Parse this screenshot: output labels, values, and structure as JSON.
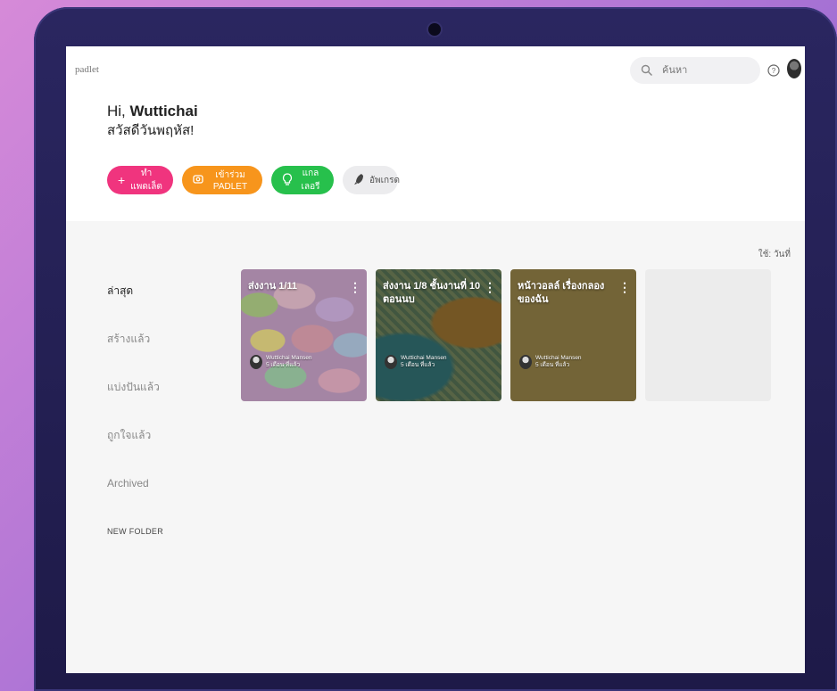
{
  "app": {
    "logo": "padlet"
  },
  "search": {
    "placeholder": "ค้นหา"
  },
  "greeting": {
    "hi_prefix": "Hi,",
    "name": "Wuttichai",
    "subtitle": "สวัสดีวันพฤหัส!"
  },
  "actions": [
    {
      "label": "ทำแพดเล็ต",
      "icon": "plus-icon",
      "color": "#f0347e"
    },
    {
      "label": "เข้าร่วม PADLET",
      "icon": "qr-scan-icon",
      "color": "#f7951c"
    },
    {
      "label": "แกลเลอรี",
      "icon": "lightbulb-icon",
      "color": "#27c04c"
    },
    {
      "label": "อัพเกรด",
      "icon": "rocket-icon",
      "color": "#ececee"
    }
  ],
  "sort": {
    "label": "ใช้: วันที่"
  },
  "sidebar": {
    "items": [
      {
        "label": "ล่าสุด",
        "active": true
      },
      {
        "label": "สร้างแล้ว"
      },
      {
        "label": "แบ่งปันแล้ว"
      },
      {
        "label": "ถูกใจแล้ว"
      },
      {
        "label": "Archived"
      }
    ],
    "new_folder": "NEW FOLDER"
  },
  "cards": [
    {
      "title": "ส่งงาน 1/11",
      "author": "Wuttichai Mansen",
      "time": "5 เดือน ที่แล้ว"
    },
    {
      "title": "ส่งงาน 1/8 ชั้นงานที่ 10 ตอนนบ",
      "author": "Wuttichai Mansen",
      "time": "5 เดือน ที่แล้ว"
    },
    {
      "title": "หน้าวอลล์ เรื่องกลอง ของฉัน",
      "author": "Wuttichai Mansen",
      "time": "5 เดือน ที่แล้ว"
    }
  ]
}
